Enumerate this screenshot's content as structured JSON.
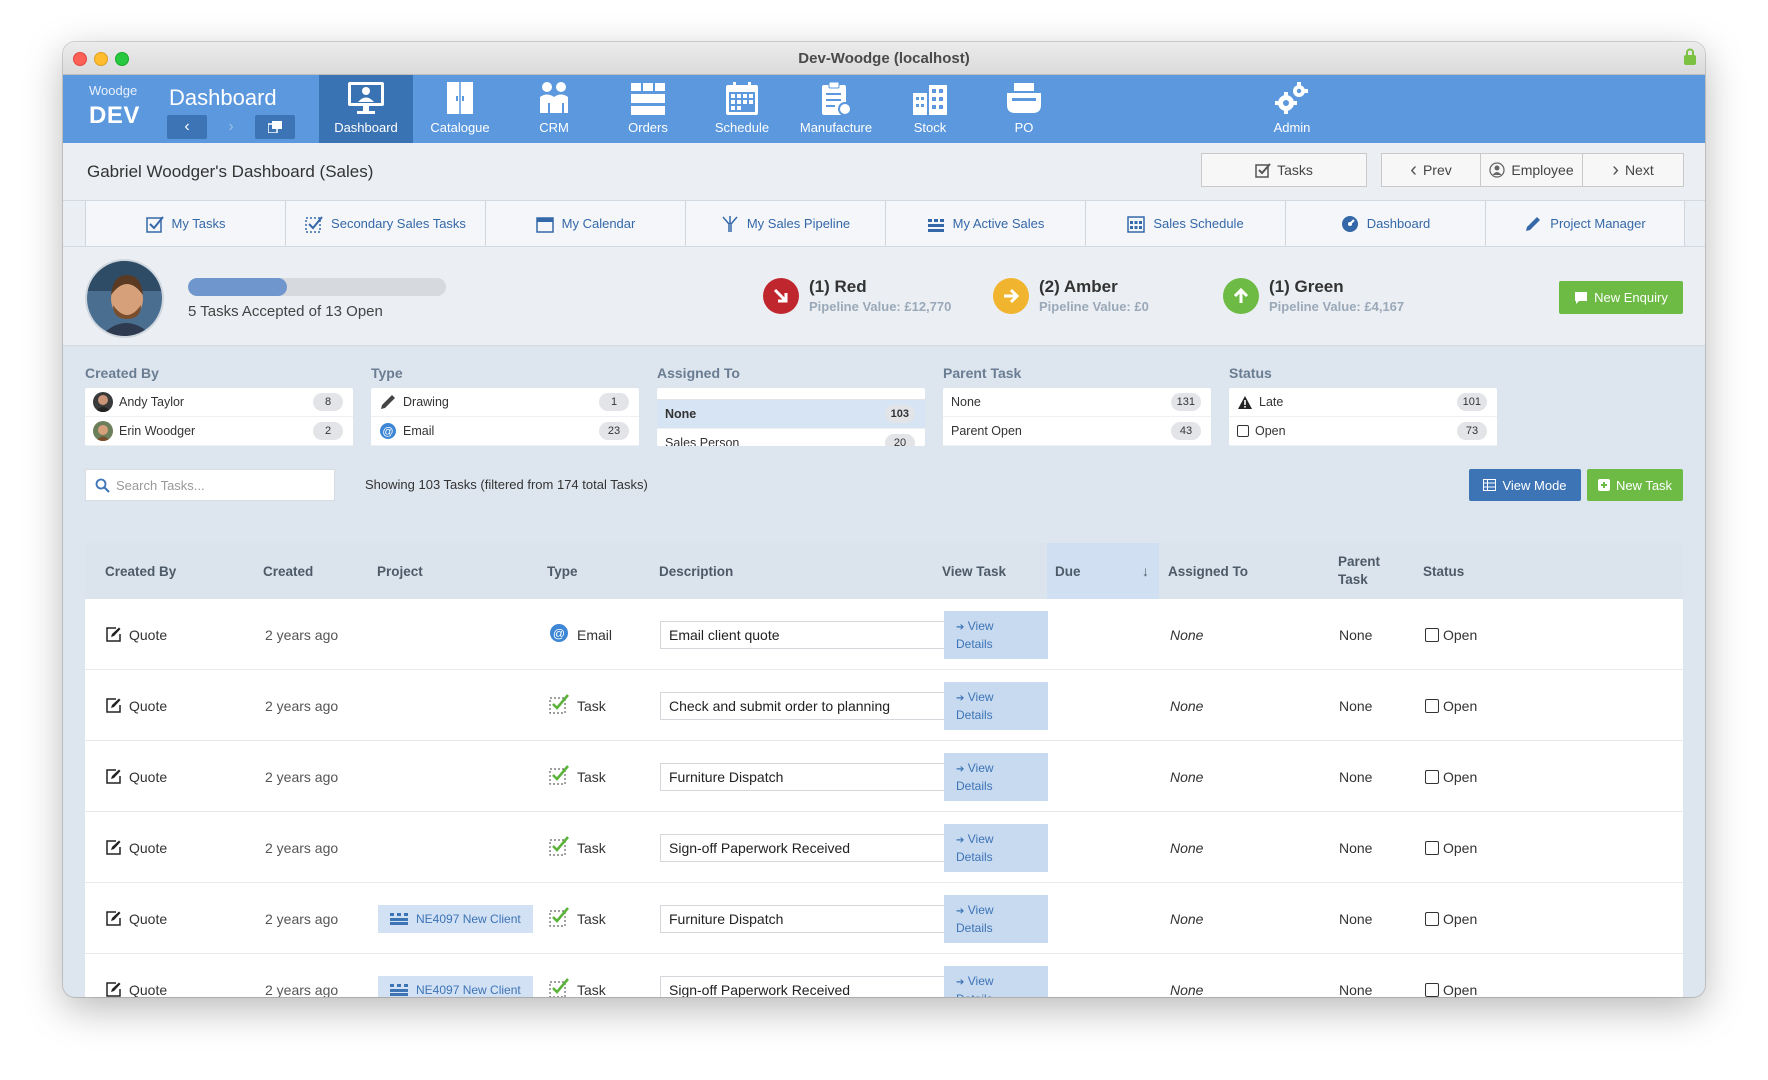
{
  "window": {
    "title": "Dev-Woodge (localhost)"
  },
  "brand": {
    "small": "Woodge",
    "big": "DEV"
  },
  "topnav": {
    "title": "Dashboard",
    "items": [
      {
        "label": "Dashboard",
        "icon": "monitor-user-icon",
        "active": true
      },
      {
        "label": "Catalogue",
        "icon": "wardrobe-icon"
      },
      {
        "label": "CRM",
        "icon": "people-icon"
      },
      {
        "label": "Orders",
        "icon": "boxes-icon"
      },
      {
        "label": "Schedule",
        "icon": "calendar-grid-icon"
      },
      {
        "label": "Manufacture",
        "icon": "clipboard-gear-icon"
      },
      {
        "label": "Stock",
        "icon": "warehouse-icon"
      },
      {
        "label": "PO",
        "icon": "printer-icon"
      },
      {
        "label": "Admin",
        "icon": "gears-icon"
      }
    ]
  },
  "header": {
    "title": "Gabriel Woodger's Dashboard (Sales)",
    "tasks_label": "Tasks",
    "prev_label": "Prev",
    "employee_label": "Employee",
    "next_label": "Next"
  },
  "tabs": [
    {
      "label": "My Tasks",
      "icon": "checkbox-icon"
    },
    {
      "label": "Secondary Sales Tasks",
      "icon": "dashed-checkbox-icon"
    },
    {
      "label": "My Calendar",
      "icon": "calendar-icon"
    },
    {
      "label": "My Sales Pipeline",
      "icon": "pipeline-icon"
    },
    {
      "label": "My Active Sales",
      "icon": "active-sales-icon"
    },
    {
      "label": "Sales Schedule",
      "icon": "schedule-icon"
    },
    {
      "label": "Dashboard",
      "icon": "gauge-icon"
    },
    {
      "label": "Project Manager",
      "icon": "pencil-icon"
    }
  ],
  "profile": {
    "progress_fraction": 0.385,
    "progress_text": "5 Tasks Accepted of 13 Open",
    "new_enquiry": "New Enquiry"
  },
  "pipelines": [
    {
      "title": "(1) Red",
      "value": "Pipeline Value: £12,770",
      "color": "#c0262d",
      "icon": "arrow-down-right-icon"
    },
    {
      "title": "(2) Amber",
      "value": "Pipeline Value: £0",
      "color": "#f1b42f",
      "icon": "arrow-right-icon"
    },
    {
      "title": "(1) Green",
      "value": "Pipeline Value: £4,167",
      "color": "#6dbb45",
      "icon": "arrow-up-icon"
    }
  ],
  "filters": {
    "created_by": {
      "title": "Created By",
      "rows": [
        {
          "label": "Andy Taylor",
          "count": "8"
        },
        {
          "label": "Erin Woodger",
          "count": "2"
        }
      ]
    },
    "type": {
      "title": "Type",
      "rows": [
        {
          "label": "Drawing",
          "count": "1"
        },
        {
          "label": "Email",
          "count": "23"
        }
      ]
    },
    "assigned_to": {
      "title": "Assigned To",
      "rows": [
        {
          "label": "None",
          "count": "103"
        },
        {
          "label": "Sales Person",
          "count": "20"
        }
      ]
    },
    "parent_task": {
      "title": "Parent Task",
      "rows": [
        {
          "label": "None",
          "count": "131"
        },
        {
          "label": "Parent Open",
          "count": "43"
        }
      ]
    },
    "status": {
      "title": "Status",
      "rows": [
        {
          "label": "Late",
          "count": "101"
        },
        {
          "label": "Open",
          "count": "73"
        }
      ]
    }
  },
  "search": {
    "placeholder": "Search Tasks...",
    "showing": "Showing 103 Tasks (filtered from 174 total Tasks)",
    "view_mode": "View Mode",
    "new_task": "New Task"
  },
  "table": {
    "columns": [
      "Created By",
      "Created",
      "Project",
      "Type",
      "Description",
      "View Task",
      "Due",
      "Assigned To",
      "Parent Task",
      "Status"
    ],
    "view_label_1": "View",
    "view_label_2": "Details",
    "rows": [
      {
        "created_by": "Quote",
        "created": "2 years ago",
        "project": "",
        "type": "Email",
        "description": "Email client quote",
        "assigned": "None",
        "parent": "None",
        "status": "Open"
      },
      {
        "created_by": "Quote",
        "created": "2 years ago",
        "project": "",
        "type": "Task",
        "description": "Check and submit order to planning",
        "assigned": "None",
        "parent": "None",
        "status": "Open"
      },
      {
        "created_by": "Quote",
        "created": "2 years ago",
        "project": "",
        "type": "Task",
        "description": "Furniture Dispatch",
        "assigned": "None",
        "parent": "None",
        "status": "Open"
      },
      {
        "created_by": "Quote",
        "created": "2 years ago",
        "project": "",
        "type": "Task",
        "description": "Sign-off Paperwork Received",
        "assigned": "None",
        "parent": "None",
        "status": "Open"
      },
      {
        "created_by": "Quote",
        "created": "2 years ago",
        "project": "NE4097 New Client",
        "type": "Task",
        "description": "Furniture Dispatch",
        "assigned": "None",
        "parent": "None",
        "status": "Open"
      },
      {
        "created_by": "Quote",
        "created": "2 years ago",
        "project": "NE4097 New Client",
        "type": "Task",
        "description": "Sign-off Paperwork Received",
        "assigned": "None",
        "parent": "None",
        "status": "Open"
      }
    ]
  }
}
